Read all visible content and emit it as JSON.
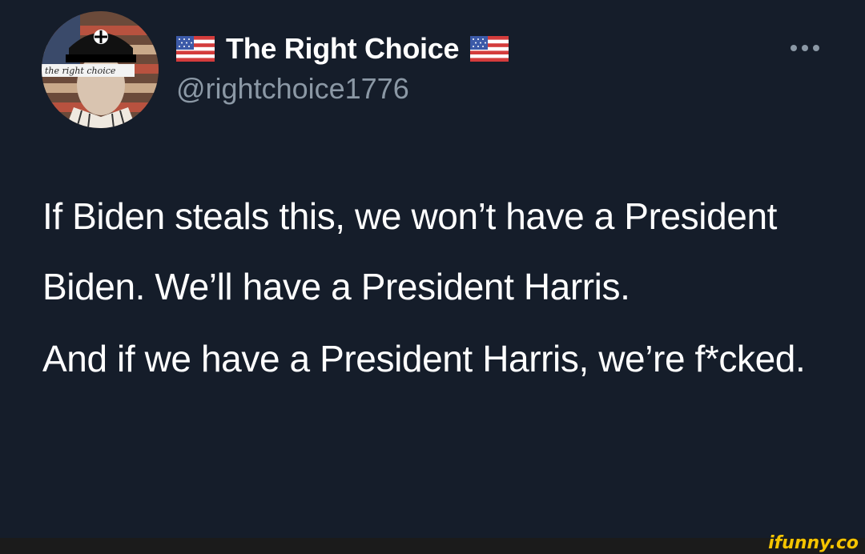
{
  "tweet": {
    "display_name": "The Right Choice",
    "handle": "@rightchoice1776",
    "avatar_caption": "the right choice",
    "name_prefix_icon": "us-flag-icon",
    "name_suffix_icon": "us-flag-icon",
    "more_icon": "more-horizontal-icon",
    "paragraphs": [
      "If Biden steals this, we won’t have a President Biden. We’ll have a President Harris.",
      "And if we have a President Harris, we’re f*cked."
    ]
  },
  "watermark": {
    "text": "ifunny.co"
  },
  "colors": {
    "background": "#151d2a",
    "primary_text": "#ffffff",
    "secondary_text": "#8b98a5",
    "watermark": "#f5c400"
  }
}
